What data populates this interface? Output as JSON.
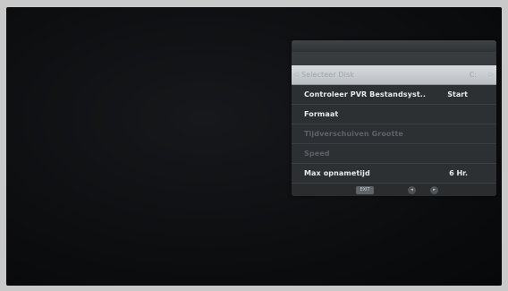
{
  "menu": {
    "items": [
      {
        "label": "Selecteer Disk",
        "value": "C:",
        "selected": true,
        "disabled": false
      },
      {
        "label": "Controleer PVR Bestandsyst..",
        "value": "Start",
        "selected": false,
        "disabled": false
      },
      {
        "label": "Formaat",
        "value": "",
        "selected": false,
        "disabled": false
      },
      {
        "label": "Tijdverschuiven Grootte",
        "value": "",
        "selected": false,
        "disabled": true
      },
      {
        "label": "Speed",
        "value": "",
        "selected": false,
        "disabled": true
      },
      {
        "label": "Max opnametijd",
        "value": "6 Hr.",
        "selected": false,
        "disabled": false
      }
    ]
  },
  "footer": {
    "exit_label": "EXIT",
    "nav_left_icon": "left-arrow-icon",
    "nav_right_icon": "right-arrow-icon"
  },
  "colors": {
    "selected_row": "#c8ccce",
    "panel_bg": "#2d3032",
    "text": "#e9ebec",
    "disabled_text": "#5d6266"
  }
}
